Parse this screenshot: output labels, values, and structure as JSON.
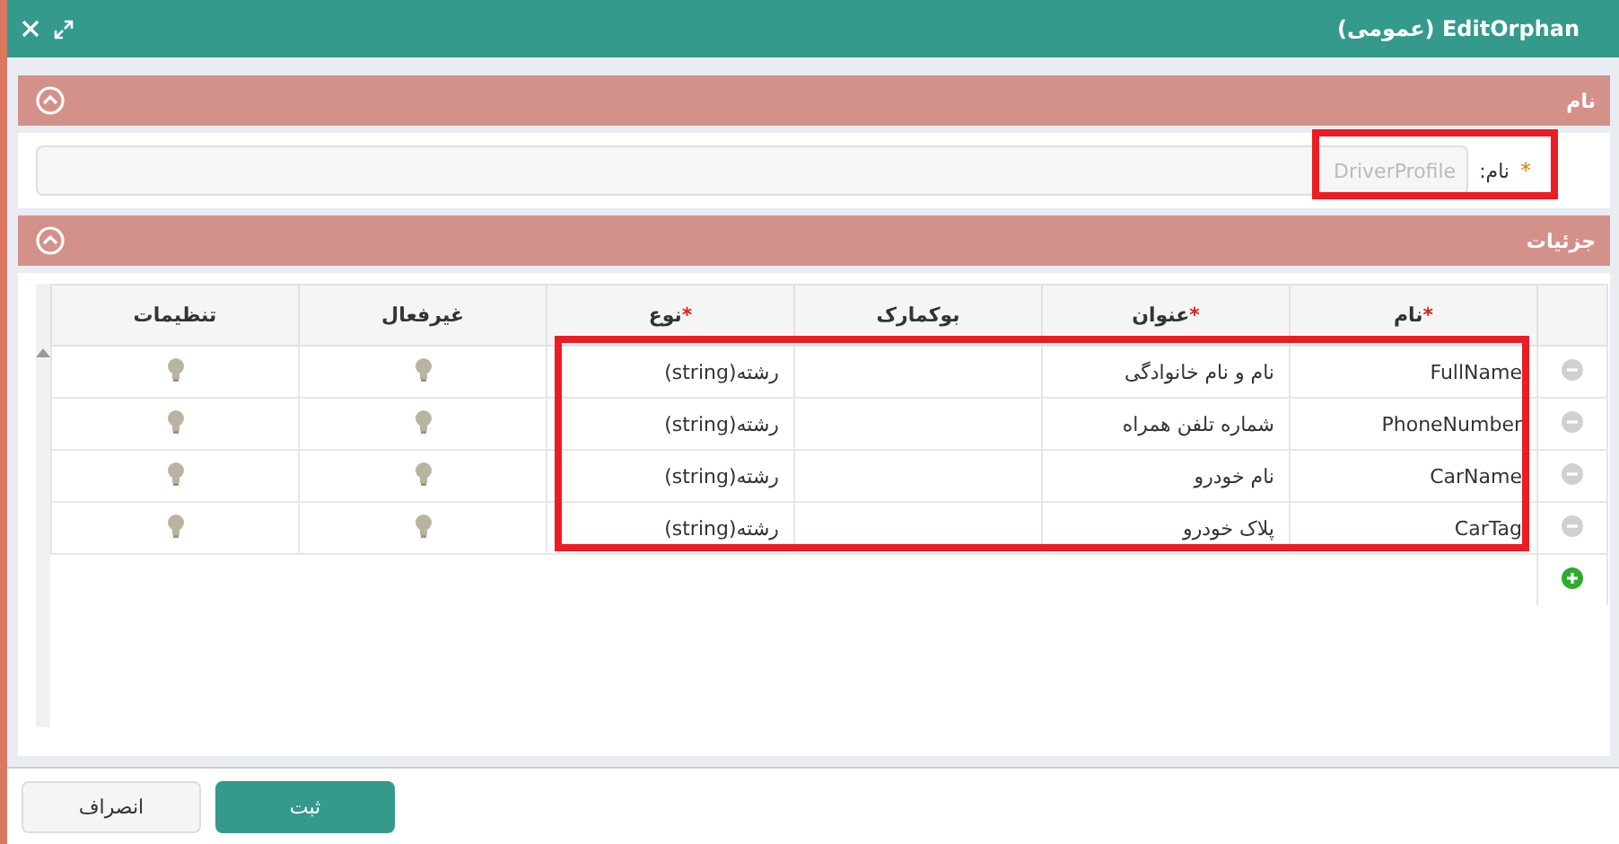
{
  "window": {
    "title": "EditOrphan (عمومی)"
  },
  "name_section": {
    "title": "نام",
    "expanded": true,
    "field": {
      "label": "نام:",
      "marker": "*",
      "value": "DriverProfile"
    }
  },
  "details_section": {
    "title": "جزئیات",
    "expanded": true
  },
  "table": {
    "columns": [
      {
        "label": "نام",
        "marker": "*"
      },
      {
        "label": "عنوان",
        "marker": "*"
      },
      {
        "label": "بوکمارک"
      },
      {
        "label": "نوع",
        "marker": "*"
      },
      {
        "label": "غیرفعال"
      },
      {
        "label": "تنظیمات"
      }
    ],
    "rows": [
      {
        "name": "FullName",
        "title": "نام و نام خانوادگی",
        "type": "رشته(string)"
      },
      {
        "name": "PhoneNumber",
        "title": "شماره تلفن همراه",
        "type": "رشته(string)"
      },
      {
        "name": "CarName",
        "title": "نام خودرو",
        "type": "رشته(string)"
      },
      {
        "name": "CarTag",
        "title": "پلاک خودرو",
        "type": "رشته(string)"
      }
    ]
  },
  "buttons": [
    {
      "label": "ثبت",
      "kind": "primary"
    },
    {
      "label": "انصراف",
      "kind": "secondary"
    }
  ]
}
